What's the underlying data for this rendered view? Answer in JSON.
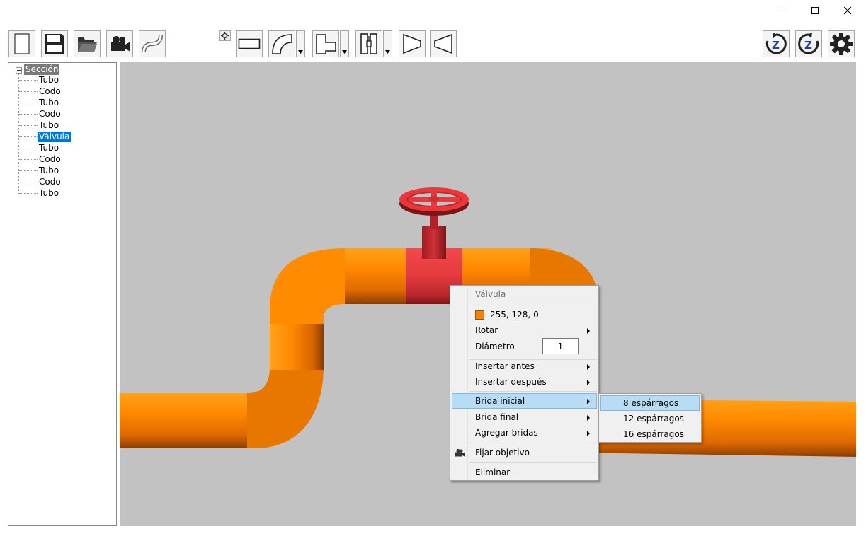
{
  "window": {
    "minimize_icon": "minimize-icon",
    "maximize_icon": "maximize-icon",
    "close_icon": "close-icon"
  },
  "toolbar": {
    "left_buttons": [
      "new-file-icon",
      "save-icon",
      "open-folder-icon",
      "camera-icon",
      "s-curve-icon"
    ],
    "small_button": "settings-small-icon",
    "shape_buttons": [
      "straight-pipe-icon",
      "elbow-icon",
      "tee-icon",
      "valve-icon",
      "reducer-icon",
      "expander-icon"
    ],
    "right_buttons": [
      "rotate-z-clockwise-icon",
      "rotate-z-counterclockwise-icon",
      "gear-icon"
    ],
    "z_label": "Z"
  },
  "tree": {
    "root": "Sección",
    "items": [
      {
        "label": "Tubo",
        "selected": false
      },
      {
        "label": "Codo",
        "selected": false
      },
      {
        "label": "Tubo",
        "selected": false
      },
      {
        "label": "Codo",
        "selected": false
      },
      {
        "label": "Tubo",
        "selected": false
      },
      {
        "label": "Válvula",
        "selected": true
      },
      {
        "label": "Tubo",
        "selected": false
      },
      {
        "label": "Codo",
        "selected": false
      },
      {
        "label": "Tubo",
        "selected": false
      },
      {
        "label": "Codo",
        "selected": false
      },
      {
        "label": "Tubo",
        "selected": false
      }
    ]
  },
  "viewport": {
    "background": "#c2c2c2",
    "pipe_color": "#ff8000",
    "valve_color": "#e8383c"
  },
  "context_menu": {
    "header": "Válvula",
    "color_value": "255, 128, 0",
    "color_swatch": "#ff8000",
    "rotate": "Rotar",
    "diameter_label": "Diámetro",
    "diameter_value": "1",
    "insert_before": "Insertar antes",
    "insert_after": "Insertar después",
    "start_flange": "Brida inicial",
    "end_flange": "Brida final",
    "add_flanges": "Agregar bridas",
    "set_target": "Fijar objetivo",
    "delete": "Eliminar"
  },
  "submenu": {
    "items": [
      "8 espárragos",
      "12 espárragos",
      "16 espárragos"
    ],
    "highlighted_index": 0
  }
}
